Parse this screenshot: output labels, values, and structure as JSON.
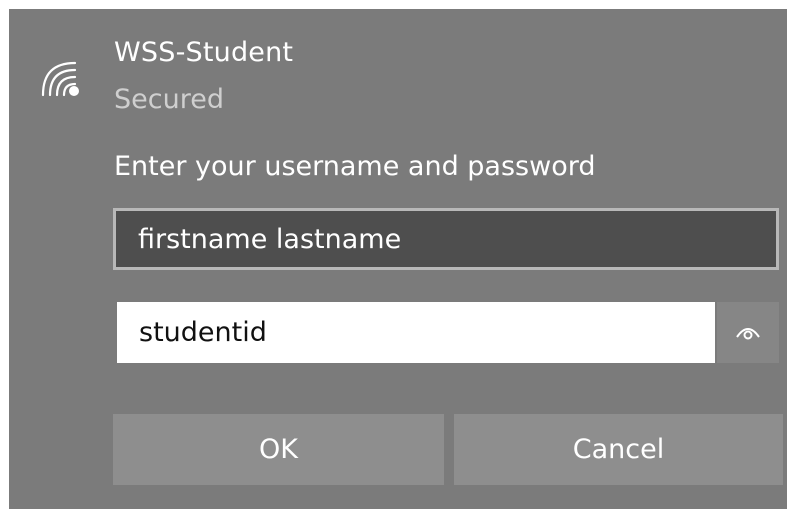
{
  "network": {
    "ssid": "WSS-Student",
    "status": "Secured",
    "icon": "wifi-secured-icon"
  },
  "prompt": "Enter your username and password",
  "username_field": {
    "value": "firstname lastname"
  },
  "password_field": {
    "value": "studentid",
    "reveal_icon": "eye-icon"
  },
  "buttons": {
    "ok_label": "OK",
    "cancel_label": "Cancel"
  },
  "colors": {
    "panel_bg": "#7b7b7b",
    "username_bg": "#4e4e4e",
    "button_bg": "#8e8e8e"
  }
}
